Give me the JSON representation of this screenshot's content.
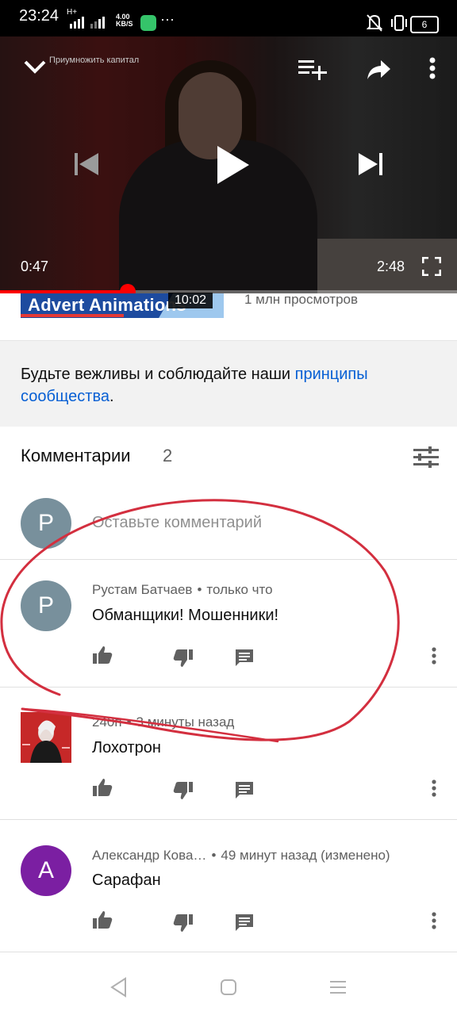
{
  "status_bar": {
    "time": "23:24",
    "network": "H+",
    "speed_value": "4.00",
    "speed_unit": "KB/S",
    "more": "···",
    "battery": "6"
  },
  "player": {
    "channel_watermark": "Приумножить капитал",
    "current_time": "0:47",
    "total_time": "2:48",
    "progress_fraction": 0.28
  },
  "ad": {
    "title": "Advert Animations",
    "duration": "10:02",
    "views": "1 млн просмотров"
  },
  "guidelines": {
    "text": "Будьте вежливы и соблюдайте наши ",
    "link": "принципы сообщества",
    "end": "."
  },
  "comments": {
    "title": "Комментарии",
    "count": "2",
    "add": {
      "avatar_letter": "P",
      "placeholder": "Оставьте комментарий"
    },
    "items": [
      {
        "avatar_letter": "P",
        "avatar_color": "#78909c",
        "author": "Рустам Батчаев",
        "time": "только что",
        "text": "Обманщики! Мошенники!"
      },
      {
        "avatar_letter": "",
        "avatar_color": "#c62828",
        "author": "240п",
        "time": "3 минуты назад",
        "text": "Лохотрон"
      },
      {
        "avatar_letter": "A",
        "avatar_color": "#7b1fa2",
        "author": "Александр Кова…",
        "time": "49 минут назад (изменено)",
        "text": "Сарафан"
      }
    ]
  },
  "colors": {
    "accent_red": "#ff0000",
    "link_blue": "#065fd4",
    "annotation_red": "#d32f3f"
  }
}
